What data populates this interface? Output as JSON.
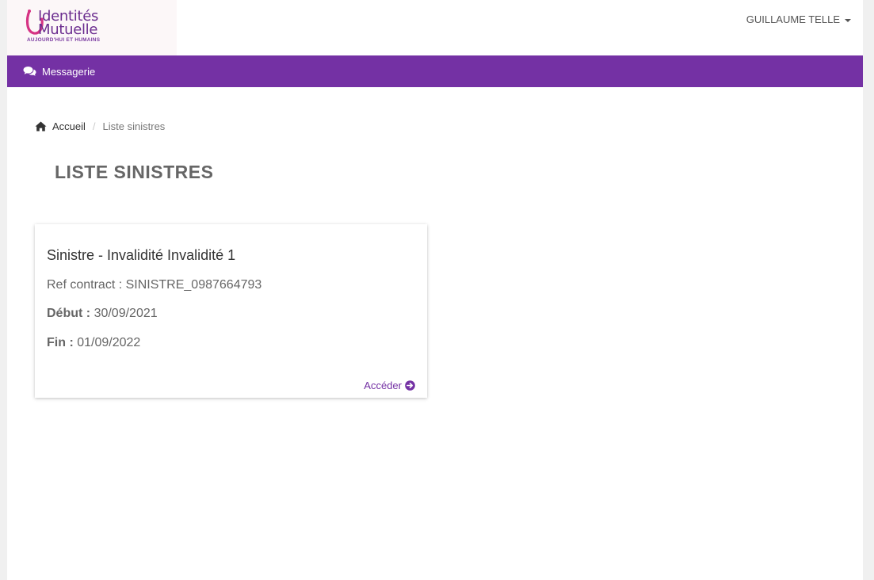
{
  "header": {
    "logo": {
      "line1": "Identités",
      "line2": "Mutuelle",
      "tagline": "AUJOURD'HUI ET HUMAINS"
    },
    "user_name": "GUILLAUME TELLE"
  },
  "nav": {
    "items": [
      {
        "label": "Messagerie",
        "icon": "comments-icon"
      }
    ]
  },
  "breadcrumb": {
    "home_label": "Accueil",
    "current_label": "Liste sinistres"
  },
  "page": {
    "title": "LISTE SINISTRES"
  },
  "cards": [
    {
      "title": "Sinistre - Invalidité Invalidité 1",
      "ref_label": "Ref contract :",
      "ref_value": "SINISTRE_0987664793",
      "debut_label": "Début :",
      "debut_value": "30/09/2021",
      "fin_label": "Fin :",
      "fin_value": "01/09/2022",
      "action_label": "Accéder"
    }
  ],
  "colors": {
    "brand_purple": "#7431a4",
    "text_gray": "#666666"
  }
}
